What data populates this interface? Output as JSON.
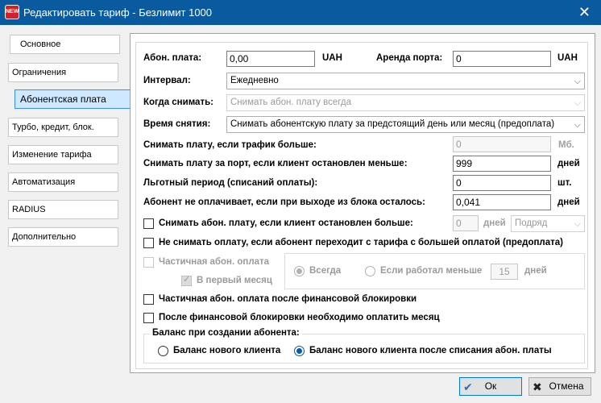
{
  "window": {
    "title": "Редактировать тариф - Безлимит 1000",
    "app_icon": "app-icon",
    "close_glyph": "✕",
    "icon_text": "NEW"
  },
  "tabs": [
    {
      "label": "Основное",
      "active": false
    },
    {
      "label": "Ограничения",
      "active": false
    },
    {
      "label": "Абонентская плата",
      "active": true
    },
    {
      "label": "Турбо, кредит, блок.",
      "active": false
    },
    {
      "label": "Изменение тарифа",
      "active": false
    },
    {
      "label": "Автоматизация",
      "active": false
    },
    {
      "label": "RADIUS",
      "active": false
    },
    {
      "label": "Дополнительно",
      "active": false
    }
  ],
  "form": {
    "fee": {
      "label": "Абон. плата:",
      "value": "0,00",
      "unit": "UAH"
    },
    "port_rent": {
      "label": "Аренда порта:",
      "value": "0",
      "unit": "UAH"
    },
    "interval": {
      "label": "Интервал:",
      "value": "Ежедневно"
    },
    "when_charge": {
      "label": "Когда снимать:",
      "value": "Снимать абон. плату всегда"
    },
    "charge_time": {
      "label": "Время снятия:",
      "value": "Снимать абонентскую плату за предстоящий день или месяц (предоплата)"
    },
    "traffic_over": {
      "label": "Снимать плату, если трафик больше:",
      "value": "0",
      "unit": "Мб."
    },
    "port_stopped_less": {
      "label": "Снимать плату за порт, если клиент остановлен меньше:",
      "value": "999",
      "unit": "дней"
    },
    "grace_period": {
      "label": "Льготный период (списаний оплаты):",
      "value": "0",
      "unit": "шт."
    },
    "not_paying_block": {
      "label": "Абонент не оплачивает, если при выходе из блока осталось:",
      "value": "0,041",
      "unit": "дней"
    },
    "stopped_more": {
      "label": "Снимать абон. плату, если клиент остановлен больше:",
      "value": "0",
      "unit": "дней",
      "mode": "Подряд",
      "checked": false
    },
    "no_charge_transfer": {
      "label": "Не снимать оплату, если абонент переходит с тарифа с большей оплатой (предоплата)",
      "checked": false
    },
    "partial": {
      "label": "Частичная абон. оплата",
      "checked": false
    },
    "first_month": {
      "label": "В первый месяц",
      "checked": true
    },
    "always": {
      "label": "Всегда",
      "checked": true
    },
    "if_worked_less": {
      "label": "Если работал меньше",
      "value": "15",
      "unit": "дней",
      "checked": false
    },
    "partial_after_block": {
      "label": "Частичная абон. оплата после финансовой блокировки",
      "checked": false
    },
    "pay_month_after_block": {
      "label": "После финансовой блокировки необходимо оплатить месяц",
      "checked": false
    },
    "balance_group": {
      "legend": "Баланс при создании абонента:",
      "option_new": {
        "label": "Баланс нового клиента",
        "checked": false
      },
      "option_after": {
        "label": "Баланс нового клиента после списания абон. платы",
        "checked": true
      }
    }
  },
  "footer": {
    "ok": {
      "label": "Ок",
      "icon": "check-icon"
    },
    "cancel": {
      "label": "Отмена",
      "icon": "close-icon"
    }
  }
}
